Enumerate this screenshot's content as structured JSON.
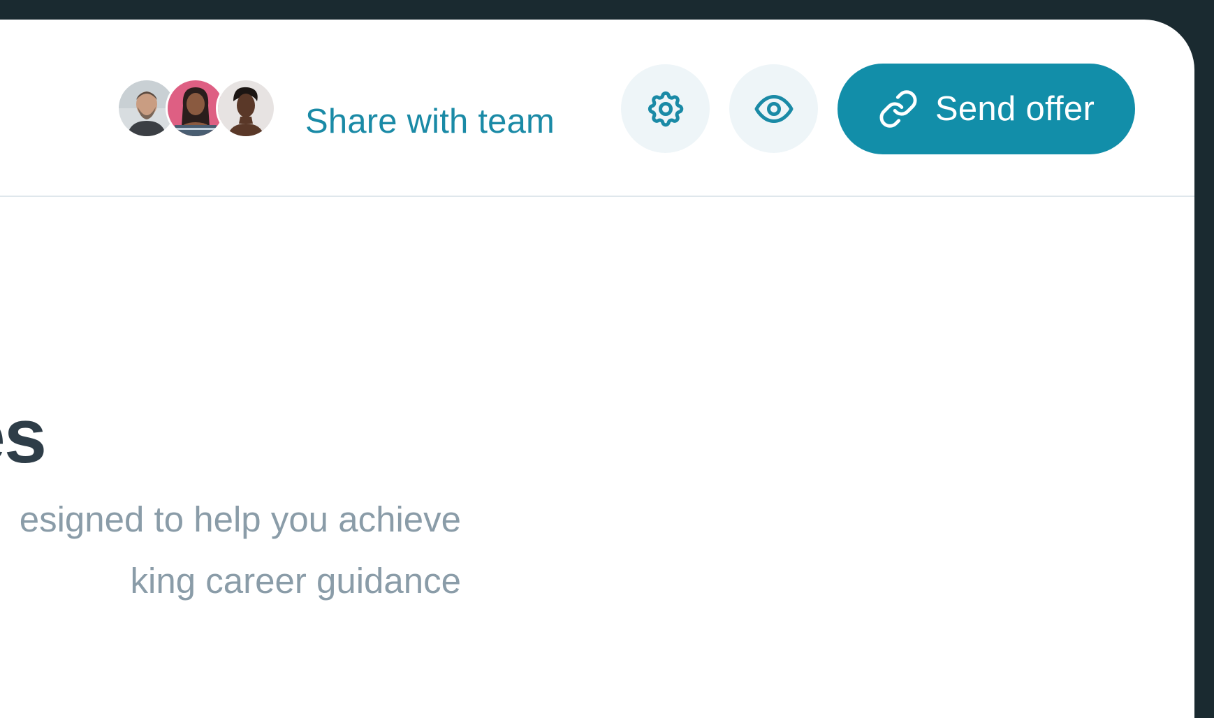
{
  "header": {
    "avatars": [
      {
        "name": "avatar-1"
      },
      {
        "name": "avatar-2"
      },
      {
        "name": "avatar-3"
      }
    ],
    "share_label": "Share with team",
    "settings_icon": "gear-icon",
    "preview_icon": "eye-icon",
    "send_offer": {
      "icon": "link-icon",
      "label": "Send offer"
    }
  },
  "main": {
    "heading_fragment": "es",
    "description_line_1": "esigned to help you achieve",
    "description_line_2": "king career guidance"
  },
  "colors": {
    "accent": "#128ea9",
    "accent_text": "#1a8aa6",
    "icon_button_bg": "#eef5f8",
    "heading": "#2e3d48",
    "muted_text": "#8a9ca8",
    "frame": "#1a2a30",
    "divider": "#dfe7ec"
  }
}
